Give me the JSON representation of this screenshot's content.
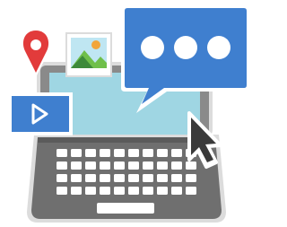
{
  "scene": {
    "description_icons": [
      "location-pin-icon",
      "landscape-photo-icon",
      "video-play-icon",
      "chat-bubble-icon",
      "mouse-cursor-icon",
      "laptop-icon"
    ],
    "colors": {
      "laptop_body": "#6f6f6f",
      "laptop_body_dark": "#5b5b5b",
      "laptop_bezel": "#8a8a8a",
      "screen": "#9fd6e3",
      "keys": "#ffffff",
      "outline": "#dcdcdc",
      "pin_red": "#e23b3b",
      "chat_blue": "#3f7fcf",
      "video_blue": "#3f7fcf",
      "photo_sky": "#bfe6f2",
      "photo_sun": "#f2a53a",
      "photo_hill_light": "#6fbf4a",
      "photo_hill_dark": "#3d8a3a",
      "cursor": "#3a3a3a",
      "dots": "#ffffff"
    },
    "chat_dots": 3,
    "keyboard_rows": [
      10,
      10,
      10,
      10
    ]
  }
}
